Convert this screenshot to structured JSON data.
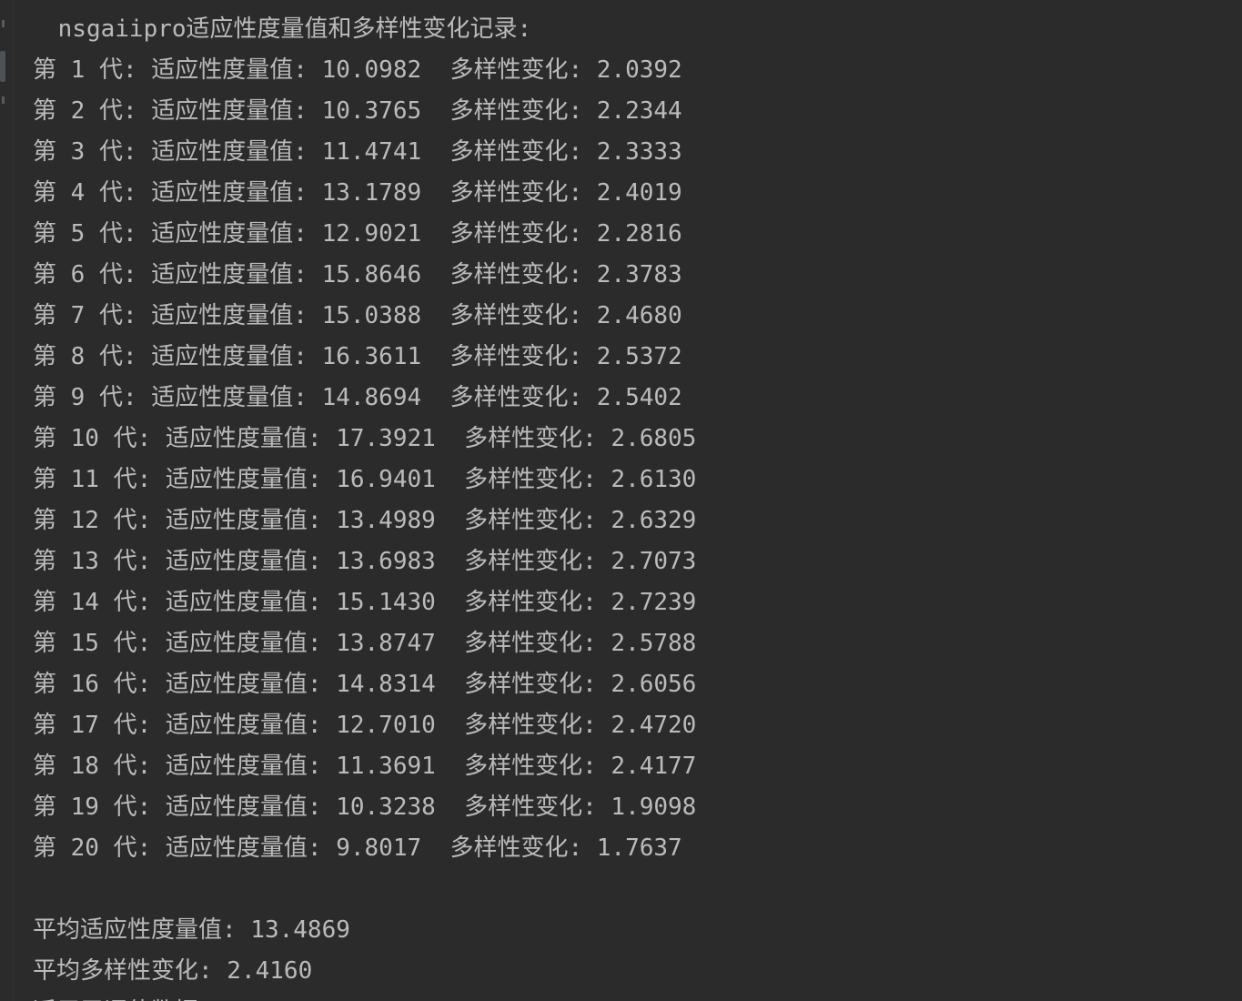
{
  "console": {
    "header": " nsgaiipro适应性度量值和多样性变化记录:",
    "generations": [
      "第 1 代: 适应性度量值: 10.0982  多样性变化: 2.0392",
      "第 2 代: 适应性度量值: 10.3765  多样性变化: 2.2344",
      "第 3 代: 适应性度量值: 11.4741  多样性变化: 2.3333",
      "第 4 代: 适应性度量值: 13.1789  多样性变化: 2.4019",
      "第 5 代: 适应性度量值: 12.9021  多样性变化: 2.2816",
      "第 6 代: 适应性度量值: 15.8646  多样性变化: 2.3783",
      "第 7 代: 适应性度量值: 15.0388  多样性变化: 2.4680",
      "第 8 代: 适应性度量值: 16.3611  多样性变化: 2.5372",
      "第 9 代: 适应性度量值: 14.8694  多样性变化: 2.5402",
      "第 10 代: 适应性度量值: 17.3921  多样性变化: 2.6805",
      "第 11 代: 适应性度量值: 16.9401  多样性变化: 2.6130",
      "第 12 代: 适应性度量值: 13.4989  多样性变化: 2.6329",
      "第 13 代: 适应性度量值: 13.6983  多样性变化: 2.7073",
      "第 14 代: 适应性度量值: 15.1430  多样性变化: 2.7239",
      "第 15 代: 适应性度量值: 13.8747  多样性变化: 2.5788",
      "第 16 代: 适应性度量值: 14.8314  多样性变化: 2.6056",
      "第 17 代: 适应性度量值: 12.7010  多样性变化: 2.4720",
      "第 18 代: 适应性度量值: 11.3691  多样性变化: 2.4177",
      "第 19 代: 适应性度量值: 10.3238  多样性变化: 1.9098",
      "第 20 代: 适应性度量值: 9.8017  多样性变化: 1.7637"
    ],
    "average_fitness": "平均适应性度量值: 13.4869",
    "average_diversity": "平均多样性变化: 2.4160",
    "cut_line": "适用于评估数据"
  },
  "colors": {
    "background": "#2b2b2b",
    "text": "#bbbbbb"
  }
}
